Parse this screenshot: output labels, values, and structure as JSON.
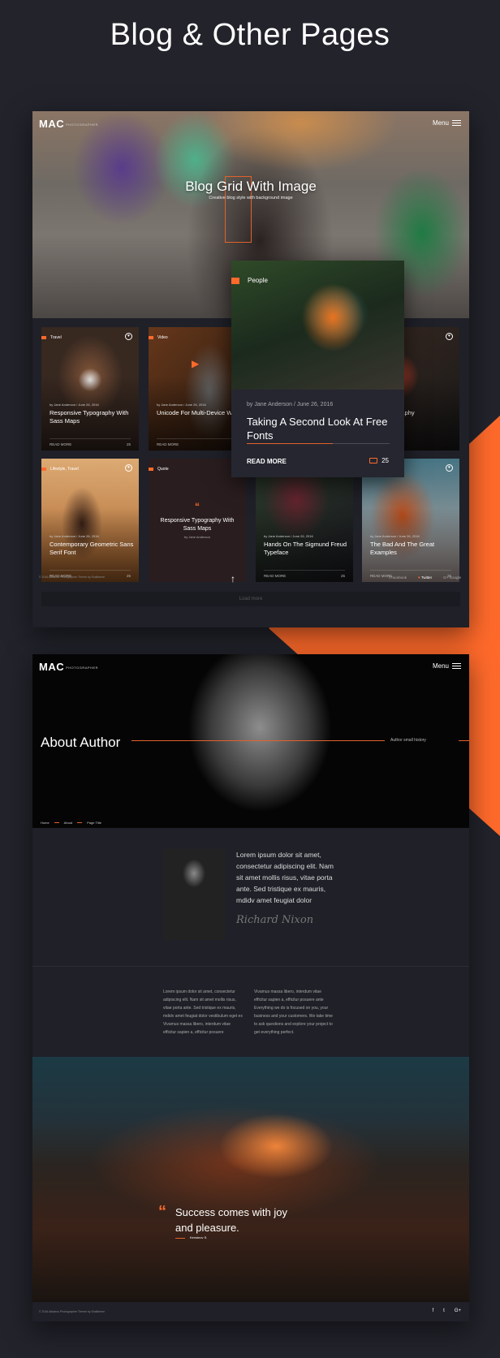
{
  "page_title": "Blog & Other Pages",
  "accent_color": "#ff6a2b",
  "blog_page": {
    "logo": "MAC",
    "logo_tagline": "PHOTOGRAPHER",
    "menu_label": "Menu",
    "hero_title": "Blog Grid With Image",
    "hero_subtitle": "Creative blog style with background image",
    "featured": {
      "category": "People",
      "meta": "by Jane Anderson / June 26, 2016",
      "title": "Taking A Second Look At Free Fonts",
      "read_more": "READ MORE",
      "comments": "25"
    },
    "cards": [
      {
        "category": "Travel",
        "meta": "by Jane Anderson / June 26, 2016",
        "title": "Responsive Typography With Sass Maps",
        "read_more": "READ MORE",
        "comments": "25"
      },
      {
        "category": "Video",
        "meta": "by Jane Anderson / June 26, 2016",
        "title": "Unicode For Multi-Device Work",
        "read_more": "READ MORE",
        "comments": "25"
      },
      {
        "category": "",
        "meta": "",
        "title": "...er Look At ...aphy",
        "read_more": "",
        "comments": ""
      },
      {
        "category": "Lifestyle, Travel",
        "meta": "by Jane Anderson / June 26, 2016",
        "title": "Contemporary Geometric Sans Serif Font",
        "read_more": "READ MORE",
        "comments": "25"
      },
      {
        "category": "Quote",
        "meta": "by Jane Anderson",
        "title": "Responsive Typography With Sass Maps",
        "read_more": "",
        "comments": ""
      },
      {
        "category": "",
        "meta": "by Jane Anderson / June 26, 2016",
        "title": "Hands On The Sigmund Freud Typeface",
        "read_more": "READ MORE",
        "comments": "25"
      },
      {
        "category": "",
        "meta": "by Jane Anderson / June 26, 2016",
        "title": "The Bad And The Great Examples",
        "read_more": "READ MORE",
        "comments": "25"
      }
    ],
    "load_more": "Load more",
    "footer": {
      "copyright": "© 2016 Albatros Photographer Theme by Exaltheme",
      "social": [
        "Facebook",
        "Twitter",
        "Google"
      ]
    }
  },
  "about_page": {
    "logo": "MAC",
    "logo_tagline": "PHOTOGRAPHER",
    "menu_label": "Menu",
    "title": "About Author",
    "subtitle": "Author small history",
    "breadcrumb": [
      "Home",
      "About",
      "Page Title"
    ],
    "intro": "Lorem ipsum dolor sit amet, consectetur adipiscing elit. Nam sit amet mollis risus, vitae porta ante. Sed tristique ex mauris, mdidv amet feugiat dolor",
    "signature": "Richard Nixon",
    "column1": "Lorem ipsum dolor sit amet, consectetur adipiscing elit. Nam sit amet mollis risus, vitae porta ante. Sed tristique ex mauris, mdidv amet feugiat dolor vestibulum eget ex Vivamus massa libero, interdum vitae efficitur sapien a, efficitur posuere",
    "column2": "Vivamus massa libero, interdum vitae efficitur sapien a, efficitur posuere ante Everything we do is focused on you, your business and your customers. We take time to ask questions and explore your project to get everything perfect.",
    "quote": "Success comes with joy and pleasure.",
    "quote_author": "Kerwinov S.",
    "footer": {
      "copyright": "© 2016 Albatros Photographer Theme by Exaltheme"
    }
  }
}
